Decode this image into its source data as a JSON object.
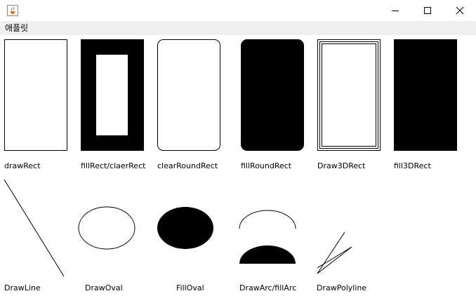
{
  "window": {
    "app_icon": "java-cup-icon",
    "controls": [
      "minimize-icon",
      "maximize-icon",
      "close-icon"
    ]
  },
  "menubar": {
    "items": [
      "애플릿"
    ]
  },
  "canvas": {
    "labels": {
      "draw_rect": "drawRect",
      "fill_rect": "fillRect/claerRect",
      "clear_round_rect": "clearRoundRect",
      "fill_round_rect": "fillRoundRect",
      "draw_3d_rect": "Draw3DRect",
      "fill_3d_rect": "fill3DRect",
      "draw_line": "DrawLine",
      "draw_oval": "DrawOval",
      "fill_oval": "FillOval",
      "draw_arc": "DrawArc/fillArc",
      "draw_polyline": "DrawPolyline"
    }
  }
}
